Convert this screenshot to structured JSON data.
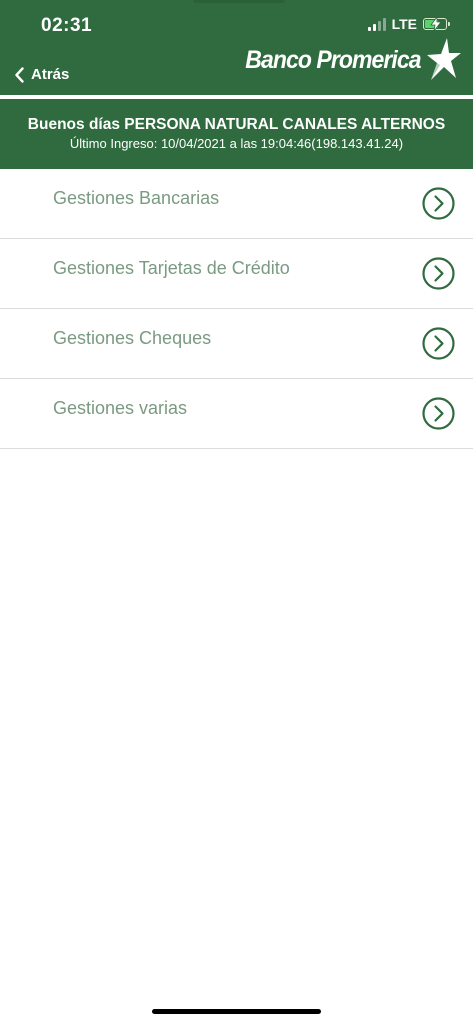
{
  "status_bar": {
    "time": "02:31",
    "network": "LTE"
  },
  "nav": {
    "back_label": "Atrás",
    "brand_name": "Banco Promerica"
  },
  "greeting": {
    "title": "Buenos días PERSONA NATURAL CANALES ALTERNOS",
    "last_login": "Último Ingreso: 10/04/2021 a las 19:04:46(198.143.41.24)"
  },
  "menu": {
    "items": [
      {
        "label": "Gestiones Bancarias"
      },
      {
        "label": "Gestiones Tarjetas de Crédito"
      },
      {
        "label": "Gestiones Cheques"
      },
      {
        "label": "Gestiones varias"
      }
    ]
  },
  "colors": {
    "brand_green": "#2f6b3e",
    "item_text": "#7a9a82",
    "chevron": "#2f6b3e",
    "battery_fill": "#5ad36a"
  },
  "icons": {
    "back": "chevron-left-icon",
    "item_arrow": "chevron-right-circle-icon",
    "logo_mark": "star-icon"
  }
}
